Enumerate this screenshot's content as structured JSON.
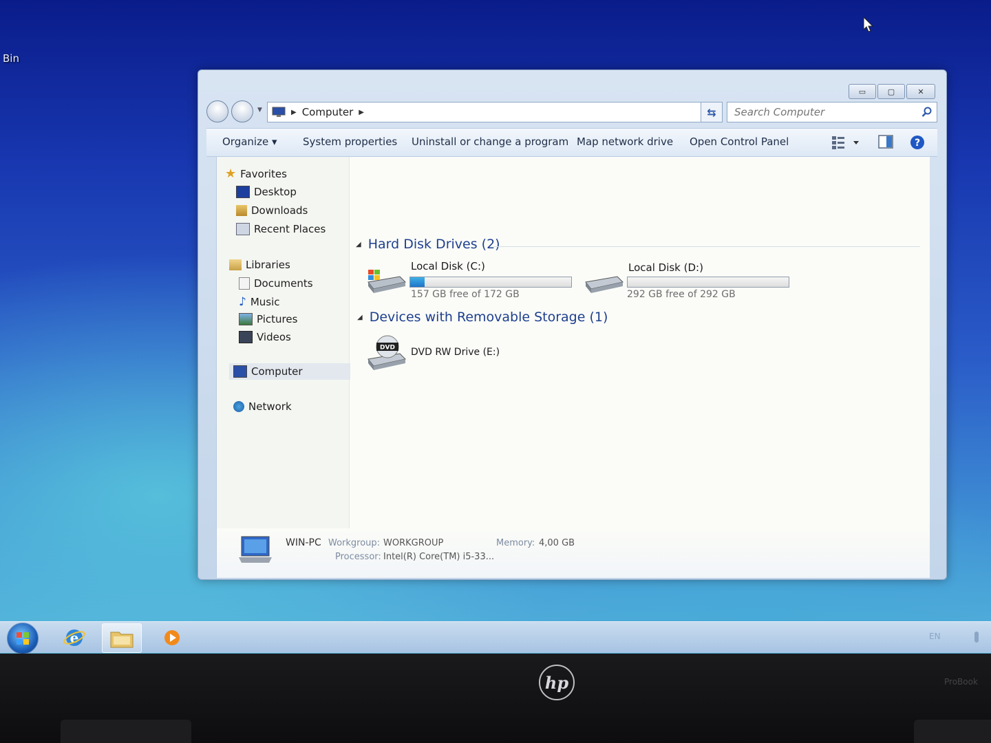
{
  "desktop": {
    "icon_label": "Bin"
  },
  "window": {
    "controls": {
      "minimize": "▭",
      "maximize": "▢",
      "close": "✕"
    },
    "address": {
      "crumb": "Computer"
    },
    "search": {
      "placeholder": "Search Computer"
    },
    "toolbar": {
      "organize": "Organize ▾",
      "system_properties": "System properties",
      "uninstall": "Uninstall or change a program",
      "map_drive": "Map network drive",
      "control_panel": "Open Control Panel"
    },
    "nav": {
      "favorites": "Favorites",
      "desktop": "Desktop",
      "downloads": "Downloads",
      "recent_places": "Recent Places",
      "libraries": "Libraries",
      "documents": "Documents",
      "music": "Music",
      "pictures": "Pictures",
      "videos": "Videos",
      "computer": "Computer",
      "network": "Network"
    },
    "groups": {
      "hard_disks": "Hard Disk Drives (2)",
      "removable": "Devices with Removable Storage (1)"
    },
    "drives": [
      {
        "name": "Local Disk (C:)",
        "free_text": "157 GB free of 172 GB",
        "used_fraction": 0.09
      },
      {
        "name": "Local Disk (D:)",
        "free_text": "292 GB free of 292 GB",
        "used_fraction": 0.0
      },
      {
        "name": "DVD RW Drive (E:)",
        "icon_text": "DVD"
      }
    ],
    "details": {
      "pc_name": "WIN-PC",
      "workgroup_label": "Workgroup:",
      "workgroup_value": "WORKGROUP",
      "memory_label": "Memory:",
      "memory_value": "4,00 GB",
      "processor_label": "Processor:",
      "processor_value": "Intel(R) Core(TM) i5-33..."
    }
  },
  "taskbar": {
    "lang": "EN"
  },
  "bezel": {
    "brand": "hp",
    "model": "ProBook"
  },
  "colors": {
    "accent": "#1e3f8f",
    "drive_fill": "#1d74c7"
  }
}
